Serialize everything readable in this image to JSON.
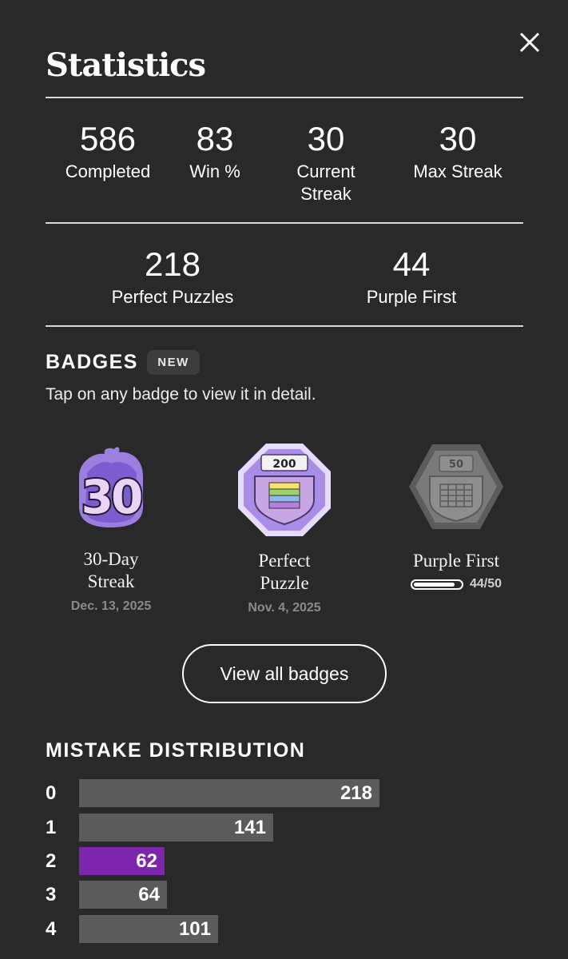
{
  "header": {
    "title": "Statistics",
    "close_icon": "close-icon"
  },
  "stats_row1": [
    {
      "value": "586",
      "label": "Completed"
    },
    {
      "value": "83",
      "label": "Win %"
    },
    {
      "value": "30",
      "label": "Current Streak"
    },
    {
      "value": "30",
      "label": "Max Streak"
    }
  ],
  "stats_row2": [
    {
      "value": "218",
      "label": "Perfect Puzzles"
    },
    {
      "value": "44",
      "label": "Purple First"
    }
  ],
  "badges": {
    "heading": "BADGES",
    "new_tag": "NEW",
    "subtitle": "Tap on any badge to view it in detail.",
    "items": [
      {
        "icon": "streak-30-badge-icon",
        "badge_text": "30",
        "name_line1": "30-Day",
        "name_line2": "Streak",
        "date": "Dec. 13, 2025"
      },
      {
        "icon": "perfect-puzzle-badge-icon",
        "badge_text": "200",
        "name_line1": "Perfect",
        "name_line2": "Puzzle",
        "date": "Nov. 4, 2025"
      },
      {
        "icon": "purple-first-badge-icon",
        "badge_text": "50",
        "name_line1": "Purple First",
        "progress_text": "44/50",
        "progress": 0.88
      }
    ],
    "view_all_label": "View all badges"
  },
  "mistake_distribution": {
    "heading": "MISTAKE DISTRIBUTION",
    "rows": [
      {
        "label": "0",
        "value": "218",
        "color": "#5b5b5b"
      },
      {
        "label": "1",
        "value": "141",
        "color": "#5b5b5b"
      },
      {
        "label": "2",
        "value": "62",
        "color": "#7d26ad"
      },
      {
        "label": "3",
        "value": "64",
        "color": "#5b5b5b"
      },
      {
        "label": "4",
        "value": "101",
        "color": "#5b5b5b"
      }
    ]
  },
  "colors": {
    "background": "#292929",
    "bar": "#5b5b5b",
    "highlight": "#7d26ad",
    "badge_purple": "#b89ee8"
  }
}
